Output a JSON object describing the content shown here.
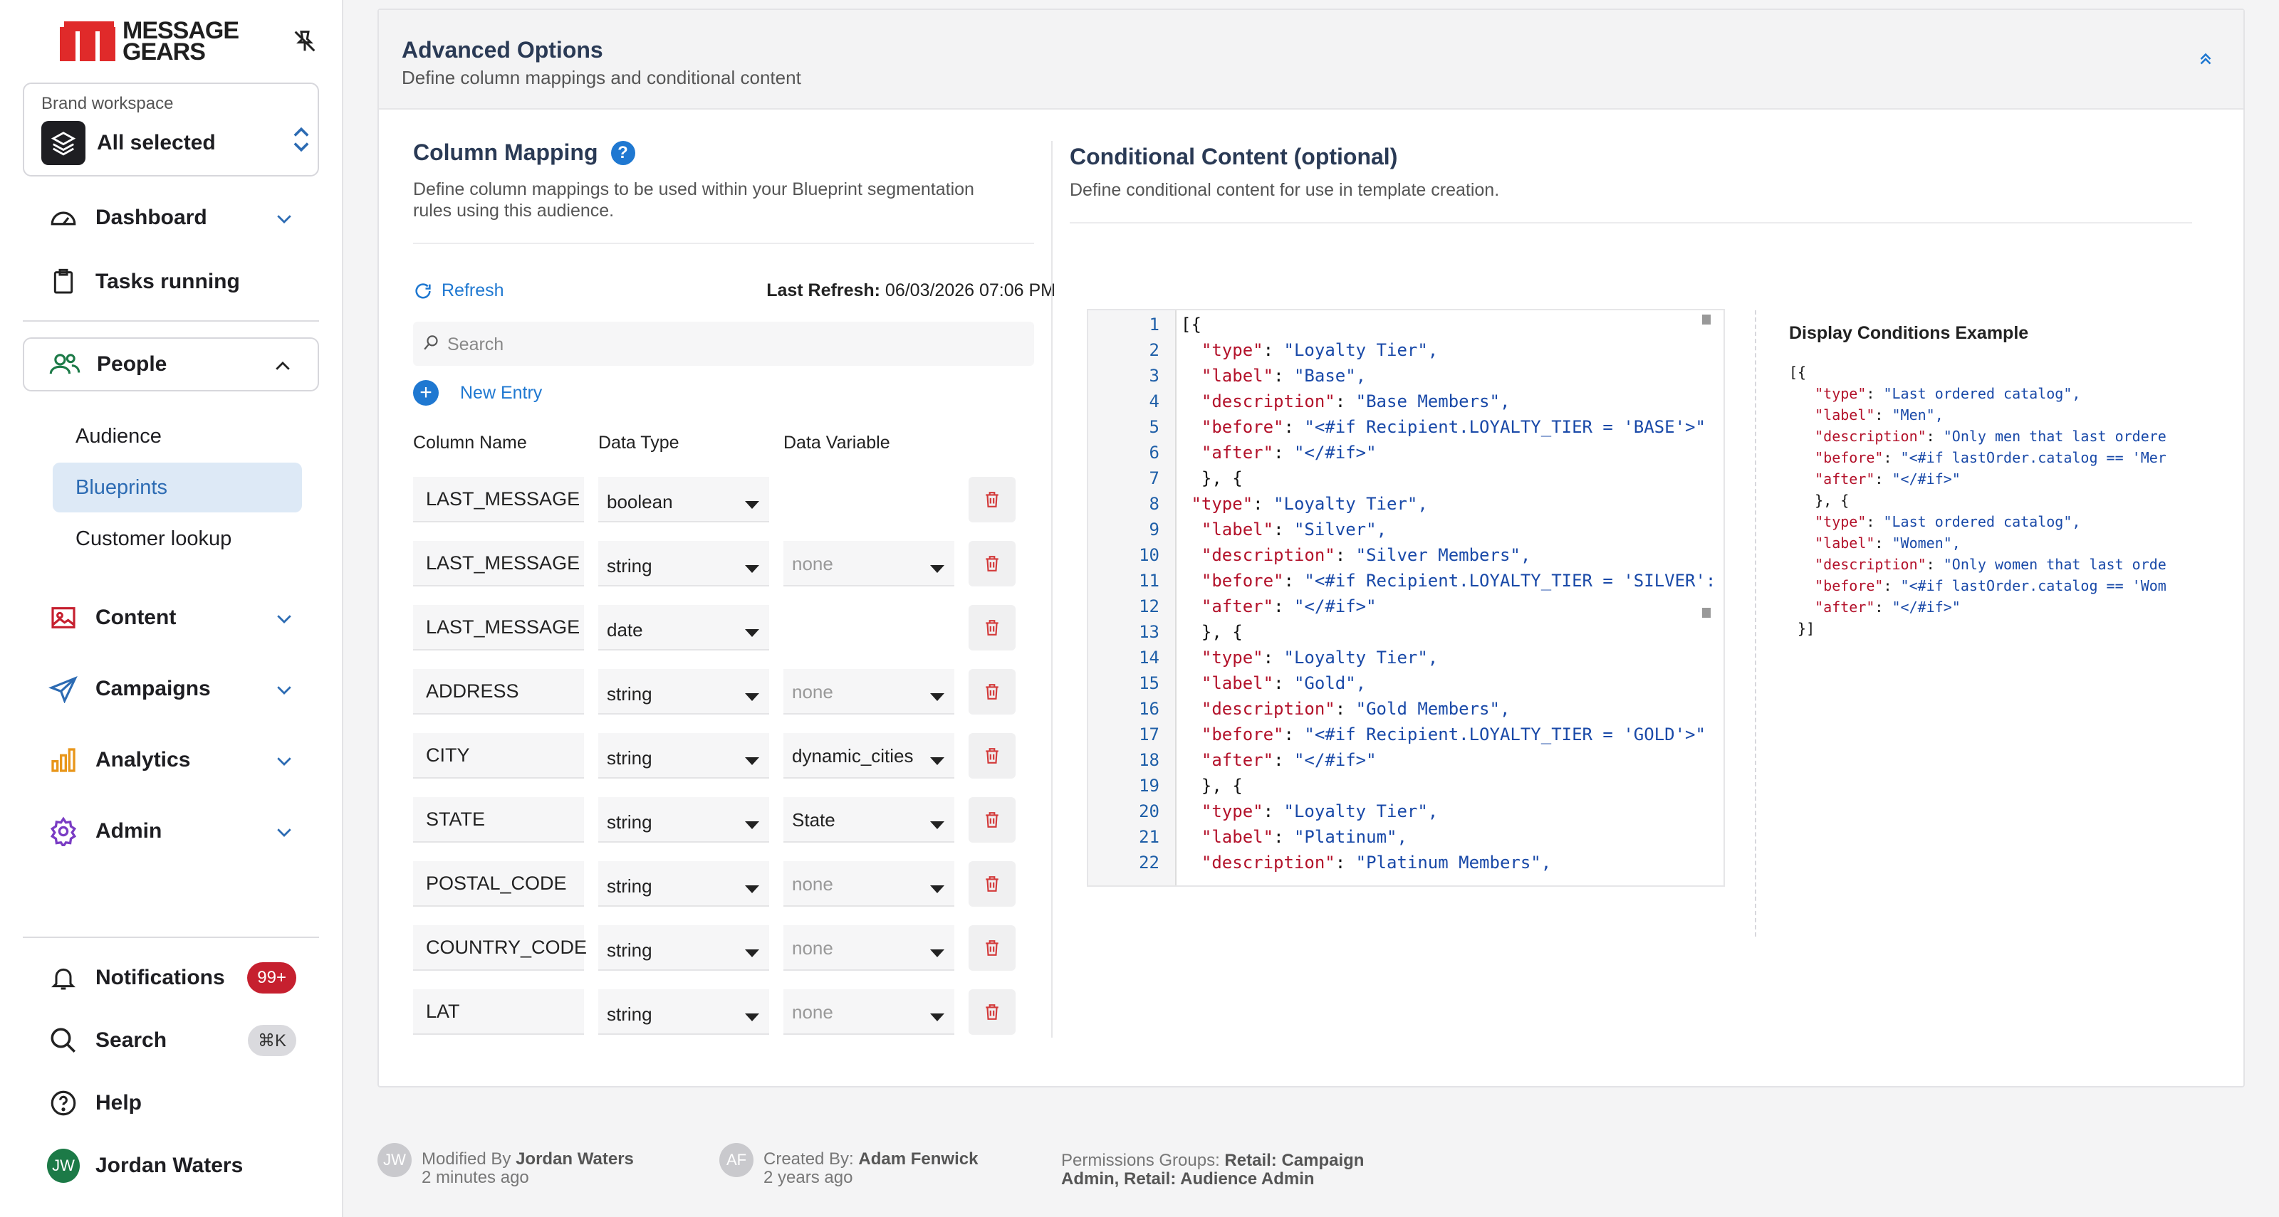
{
  "brand": {
    "name_line1": "MESSAGE",
    "name_line2": "GEARS",
    "accent": "#e02a2a"
  },
  "workspace": {
    "label": "Brand workspace",
    "value": "All selected"
  },
  "nav": {
    "dashboard": "Dashboard",
    "tasks": "Tasks running",
    "people": "People",
    "people_sub": [
      "Audience",
      "Blueprints",
      "Customer lookup"
    ],
    "content": "Content",
    "campaigns": "Campaigns",
    "analytics": "Analytics",
    "admin": "Admin",
    "notifications": "Notifications",
    "notifications_badge": "99+",
    "search": "Search",
    "search_shortcut": "⌘K",
    "help": "Help",
    "user_name": "Jordan Waters",
    "user_initials": "JW"
  },
  "panel": {
    "title": "Advanced Options",
    "subtitle": "Define column mappings and conditional content"
  },
  "column_mapping": {
    "title": "Column Mapping",
    "description": "Define column mappings to be used within your Blueprint segmentation rules using this audience.",
    "refresh_label": "Refresh",
    "last_refresh_label": "Last Refresh:",
    "last_refresh_value": "06/03/2026 07:06 PM",
    "search_placeholder": "Search",
    "new_entry_label": "New Entry",
    "headers": {
      "name": "Column Name",
      "type": "Data Type",
      "variable": "Data Variable"
    },
    "rows": [
      {
        "name": "LAST_MESSAGE",
        "type": "boolean",
        "variable": ""
      },
      {
        "name": "LAST_MESSAGE",
        "type": "string",
        "variable": "none"
      },
      {
        "name": "LAST_MESSAGE",
        "type": "date",
        "variable": ""
      },
      {
        "name": "ADDRESS",
        "type": "string",
        "variable": "none"
      },
      {
        "name": "CITY",
        "type": "string",
        "variable": "dynamic_cities"
      },
      {
        "name": "STATE",
        "type": "string",
        "variable": "State"
      },
      {
        "name": "POSTAL_CODE",
        "type": "string",
        "variable": "none"
      },
      {
        "name": "COUNTRY_CODE",
        "type": "string",
        "variable": "none"
      },
      {
        "name": "LAT",
        "type": "string",
        "variable": "none"
      }
    ]
  },
  "conditional_content": {
    "title": "Conditional Content (optional)",
    "description": "Define conditional content for use in template creation.",
    "code_lines": [
      "[{",
      "  \"type\": \"Loyalty Tier\",",
      "  \"label\": \"Base\",",
      "  \"description\": \"Base Members\",",
      "  \"before\": \"<#if Recipient.LOYALTY_TIER = 'BASE'>\"",
      "  \"after\": \"</#if>\"",
      "  }, {",
      " \"type\": \"Loyalty Tier\",",
      "  \"label\": \"Silver\",",
      "  \"description\": \"Silver Members\",",
      "  \"before\": \"<#if Recipient.LOYALTY_TIER = 'SILVER':",
      "  \"after\": \"</#if>\"",
      "  }, {",
      "  \"type\": \"Loyalty Tier\",",
      "  \"label\": \"Gold\",",
      "  \"description\": \"Gold Members\",",
      "  \"before\": \"<#if Recipient.LOYALTY_TIER = 'GOLD'>\"",
      "  \"after\": \"</#if>\"",
      "  }, {",
      "  \"type\": \"Loyalty Tier\",",
      "  \"label\": \"Platinum\",",
      "  \"description\": \"Platinum Members\","
    ],
    "example_title": "Display Conditions Example",
    "example_lines": [
      "[{",
      "   \"type\": \"Last ordered catalog\",",
      "   \"label\": \"Men\",",
      "   \"description\": \"Only men that last ordere",
      "   \"before\": \"<#if lastOrder.catalog == 'Mer",
      "   \"after\": \"</#if>\"",
      "   }, {",
      "   \"type\": \"Last ordered catalog\",",
      "   \"label\": \"Women\",",
      "   \"description\": \"Only women that last orde",
      "   \"before\": \"<#if lastOrder.catalog == 'Wom",
      "   \"after\": \"</#if>\"",
      " }]"
    ]
  },
  "footer": {
    "modified_label": "Modified By",
    "modified_by": "Jordan Waters",
    "modified_initials": "JW",
    "modified_time": "2 minutes ago",
    "created_label": "Created By:",
    "created_by": "Adam Fenwick",
    "created_initials": "AF",
    "created_time": "2 years ago",
    "permissions_label": "Permissions Groups:",
    "permissions_line1": "Retail: Campaign",
    "permissions_line2": "Admin, Retail: Audience Admin"
  }
}
